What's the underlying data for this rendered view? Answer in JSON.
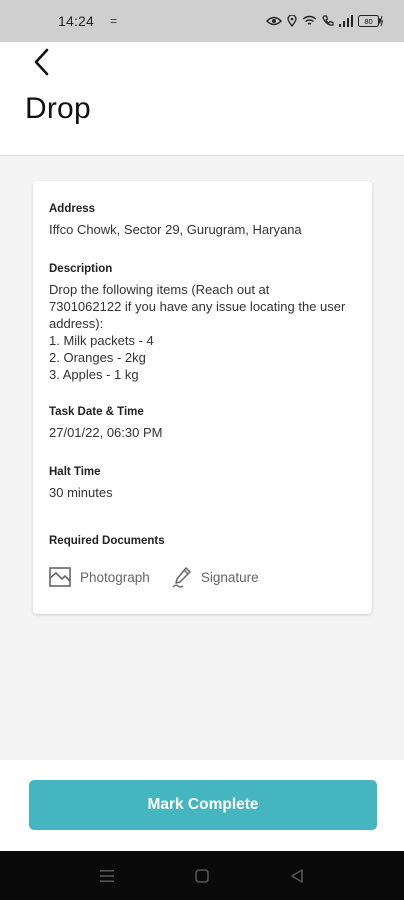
{
  "status_bar": {
    "time": "14:24",
    "notif_glyph": "=",
    "battery": "80"
  },
  "header": {
    "back_icon": "chevron-left-icon",
    "title": "Drop"
  },
  "card": {
    "address": {
      "label": "Address",
      "value": "Iffco Chowk, Sector 29, Gurugram, Haryana"
    },
    "description": {
      "label": "Description",
      "lines": [
        "Drop the following items (Reach out at",
        "7301062122 if you have any issue locating the user",
        "address):",
        "1. Milk packets - 4",
        "2. Oranges - 2kg",
        "3. Apples - 1 kg"
      ]
    },
    "task_date": {
      "label": "Task Date & Time",
      "value": "27/01/22, 06:30 PM"
    },
    "halt_time": {
      "label": "Halt Time",
      "value": "30 minutes"
    },
    "required_documents": {
      "label": "Required Documents",
      "items": [
        {
          "label": "Photograph",
          "icon": "image-icon"
        },
        {
          "label": "Signature",
          "icon": "pen-signature-icon"
        }
      ]
    }
  },
  "actions": {
    "mark_complete": "Mark Complete",
    "color": "#45b5bf"
  },
  "nav_bar": {
    "icons": [
      "menu-icon",
      "home-icon",
      "back-icon"
    ]
  }
}
